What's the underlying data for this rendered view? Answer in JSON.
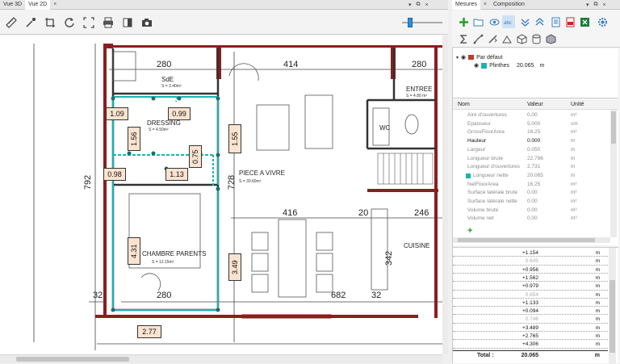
{
  "left_tabs": [
    {
      "label": "Vue 3D"
    },
    {
      "label": "Vue 2D"
    }
  ],
  "right_tabs": [
    {
      "label": "Mesures"
    },
    {
      "label": "Composition"
    }
  ],
  "close_glyph": "×",
  "win_controls": {
    "menu": "▾",
    "float": "⧉",
    "close": "×"
  },
  "toolbar_icons": [
    "ruler-icon",
    "eyedropper-icon",
    "crop-icon",
    "rotate-icon",
    "fit-icon",
    "print-icon",
    "contrast-icon",
    "camera-icon"
  ],
  "plan": {
    "dims": {
      "d280a": "280",
      "d414": "414",
      "d280b": "280",
      "d792": "792",
      "d728": "728",
      "d416": "416",
      "d20": "20",
      "d246": "246",
      "d32a": "32",
      "d280c": "280",
      "d682": "682",
      "d32b": "32",
      "d342": "342"
    },
    "rooms": {
      "sde": "SdE",
      "sde_area": "S = 3.40m²",
      "dressing": "DRESSING",
      "dressing_area": "S = 4.50m²",
      "wc": "WC",
      "entree": "ENTREE",
      "entree_area": "S = 4.80 m²",
      "piece": "PIECE A VIVRE",
      "piece_area": "S = 39.60m²",
      "cuisine": "CUISINE",
      "chambre": "CHAMBRE PARENTS",
      "chambre_area": "S = 12.15m²"
    },
    "tags": {
      "t109": "1.09",
      "t099": "0.99",
      "t156": "1.56",
      "t155": "1.55",
      "t075": "0.75",
      "t098": "0.98",
      "t113": "1.13",
      "t431": "4.31",
      "t349": "3.49",
      "t277": "2.77"
    }
  },
  "ribbon_icons": [
    "add-icon",
    "folder-icon",
    "eye-icon",
    "abc-icon",
    "expand-icon",
    "collapse-icon",
    "document-icon",
    "pdf-icon",
    "excel-icon",
    "settings-icon",
    "sum-icon",
    "path-icon",
    "measure-tool-icon",
    "shapes-icon",
    "cube-icon",
    "cylinder-icon",
    "box-icon"
  ],
  "tree": {
    "root": "Par défaut",
    "child_label": "Plinthes",
    "child_value": "20.065",
    "child_unit": "m"
  },
  "props": {
    "headers": {
      "name": "Nom",
      "value": "Valeur",
      "unit": "Unité"
    },
    "rows": [
      {
        "name": "Aire d'ouvertures",
        "value": "0.00",
        "unit": "m²",
        "hl": false
      },
      {
        "name": "Epaisseur",
        "value": "5.000",
        "unit": "cm",
        "hl": false
      },
      {
        "name": "GrossFloorArea",
        "value": "16.25",
        "unit": "m²",
        "hl": false
      },
      {
        "name": "Hauteur",
        "value": "0.000",
        "unit": "m",
        "hl": true
      },
      {
        "name": "Largeur",
        "value": "0.050",
        "unit": "m",
        "hl": false
      },
      {
        "name": "Longueur brute",
        "value": "22.796",
        "unit": "m",
        "hl": false
      },
      {
        "name": "Longueur d'ouvertures",
        "value": "2.731",
        "unit": "m",
        "hl": false
      },
      {
        "name": "Longueur nette",
        "value": "20.065",
        "unit": "m",
        "hl": false
      },
      {
        "name": "NetFloorArea",
        "value": "16.25",
        "unit": "m²",
        "hl": false
      },
      {
        "name": "Surface latérale brute",
        "value": "0.00",
        "unit": "m²",
        "hl": false
      },
      {
        "name": "Surface latérale nette",
        "value": "0.00",
        "unit": "m²",
        "hl": false
      },
      {
        "name": "Volume brute",
        "value": "0.00",
        "unit": "m³",
        "hl": false
      },
      {
        "name": "Volume net",
        "value": "0.00",
        "unit": "m³",
        "hl": false
      }
    ],
    "swatch": "#19b3b3"
  },
  "measures": {
    "rows": [
      {
        "value": "+1.154",
        "unit": "m",
        "grey": false
      },
      {
        "value": "0.645",
        "unit": "m",
        "grey": true
      },
      {
        "value": "+0.956",
        "unit": "m",
        "grey": false
      },
      {
        "value": "+1.562",
        "unit": "m",
        "grey": false
      },
      {
        "value": "+0.979",
        "unit": "m",
        "grey": false
      },
      {
        "value": "0.654",
        "unit": "m",
        "grey": true
      },
      {
        "value": "+1.133",
        "unit": "m",
        "grey": false
      },
      {
        "value": "+0.094",
        "unit": "m",
        "grey": false
      },
      {
        "value": "0.746",
        "unit": "m",
        "grey": true
      },
      {
        "value": "+3.489",
        "unit": "m",
        "grey": false
      },
      {
        "value": "+2.765",
        "unit": "m",
        "grey": false
      },
      {
        "value": "+4.306",
        "unit": "m",
        "grey": false
      }
    ],
    "total_label": "Total :",
    "total_value": "20.065",
    "total_unit": "m"
  },
  "colors": {
    "accent": "#2a8fd8",
    "selection": "#19b3b3",
    "wall": "#8b1e1e",
    "tag_bg": "#fbe3cf"
  }
}
